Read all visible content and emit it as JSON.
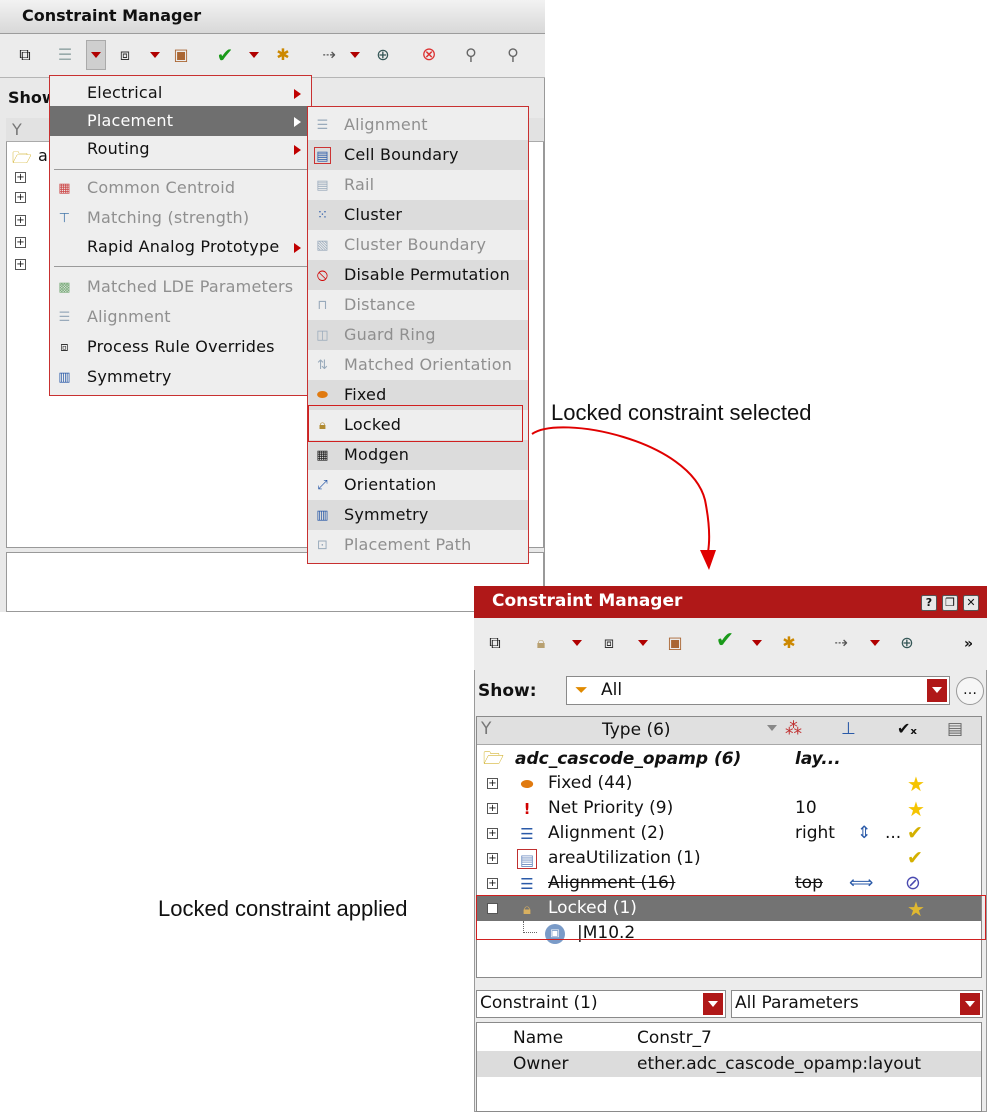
{
  "cm1": {
    "title": "Constraint Manager",
    "show_label": "Show",
    "tree_root_letter": "a"
  },
  "menu1": {
    "items": [
      {
        "label": "Electrical"
      },
      {
        "label": "Placement"
      },
      {
        "label": "Routing"
      },
      {
        "label": "Common Centroid"
      },
      {
        "label": "Matching (strength)"
      },
      {
        "label": "Rapid Analog Prototype"
      },
      {
        "label": "Matched LDE Parameters"
      },
      {
        "label": "Alignment"
      },
      {
        "label": "Process Rule Overrides"
      },
      {
        "label": "Symmetry"
      }
    ]
  },
  "menu2": {
    "items": [
      {
        "label": "Alignment"
      },
      {
        "label": "Cell Boundary"
      },
      {
        "label": "Rail"
      },
      {
        "label": "Cluster"
      },
      {
        "label": "Cluster Boundary"
      },
      {
        "label": "Disable Permutation"
      },
      {
        "label": "Distance"
      },
      {
        "label": "Guard Ring"
      },
      {
        "label": "Matched Orientation"
      },
      {
        "label": "Fixed"
      },
      {
        "label": "Locked"
      },
      {
        "label": "Modgen"
      },
      {
        "label": "Orientation"
      },
      {
        "label": "Symmetry"
      },
      {
        "label": "Placement Path"
      }
    ]
  },
  "annotations": {
    "selected": "Locked constraint selected",
    "applied": "Locked constraint applied"
  },
  "cm2": {
    "title": "Constraint Manager",
    "more": "»",
    "show_label": "Show:",
    "filter_value": "All",
    "filter_more": "…",
    "columns": {
      "type": "Type (6)"
    },
    "root": {
      "name": "adc_cascode_opamp (6)",
      "view": "lay..."
    },
    "rows": [
      {
        "name": "Fixed (44)",
        "value": ""
      },
      {
        "name": "Net Priority (9)",
        "value": "10"
      },
      {
        "name": "Alignment (2)",
        "value": "right",
        "extra": "..."
      },
      {
        "name": "areaUtilization (1)",
        "value": ""
      },
      {
        "name": "Alignment (16)",
        "value": "top"
      },
      {
        "name": "Locked (1)",
        "value": ""
      }
    ],
    "child": {
      "name": "|M10.2"
    },
    "prop_selector": "Constraint (1)",
    "param_selector": "All Parameters",
    "props": [
      {
        "key": "Name",
        "value": "Constr_7"
      },
      {
        "key": "Owner",
        "value": "ether.adc_cascode_opamp:layout"
      }
    ]
  }
}
